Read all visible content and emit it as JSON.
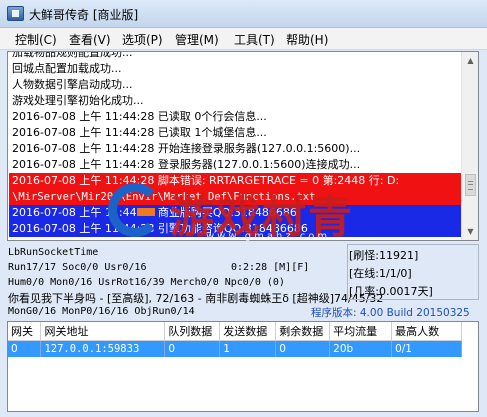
{
  "window": {
    "title": "大鲜哥传奇 [商业版]"
  },
  "menu": [
    {
      "label": "控制(C)"
    },
    {
      "label": "查看(V)"
    },
    {
      "label": "选项(P)"
    },
    {
      "label": "管理(M)"
    },
    {
      "label": "工具(T)"
    },
    {
      "label": "帮助(H)"
    }
  ],
  "log": [
    {
      "text": "加载物品规则配置成功...",
      "style": "normal"
    },
    {
      "text": "回城点配置加载成功...",
      "style": "normal"
    },
    {
      "text": "人物数据引擎启动成功...",
      "style": "normal"
    },
    {
      "text": "游戏处理引擎初始化成功...",
      "style": "normal"
    },
    {
      "text": "2016-07-08 上午 11:44:28 已读取 0个行会信息...",
      "style": "normal"
    },
    {
      "text": "2016-07-08 上午 11:44:28 已读取 1个城堡信息...",
      "style": "normal"
    },
    {
      "text": "2016-07-08 上午 11:44:28 开始连接登录服务器(127.0.0.1:5600)...",
      "style": "normal"
    },
    {
      "text": "2016-07-08 上午 11:44:28 登录服务器(127.0.0.1:5600)连接成功...",
      "style": "normal"
    },
    {
      "text": "2016-07-08 上午 11:44:28 脚本错误: RRTARGETRACE = 0 第:2448 行: D:",
      "style": "red"
    },
    {
      "text": "\\MirServer\\Mir200\\Envir\\Market_Def\\Functions.txt",
      "style": "red mono"
    },
    {
      "text": "2016-07-08 上午 11:44:28 商业版购买QQ:318486686",
      "style": "blue"
    },
    {
      "text": "2016-07-08 上午 11:44:28 引擎功能咨询QQ:318486686",
      "style": "blue"
    }
  ],
  "watermark": {
    "brand": "G",
    "word": "游戏村青",
    "url": "www.gmahz.com"
  },
  "status": {
    "socket": "LbRunSocketTime",
    "run": "Run17/17 Soc0/0 Usr0/16",
    "time": "0:2:28 [M][F]",
    "hum": "Hum0/0 Mon0/16 UsrRot16/39 Merch0/0 Npc0/0 (0)",
    "notice": "你看见我下半身吗 - [至高级], 72/163 - 南非剧毒蜘蛛王δ [超神级]74/45/32",
    "mon": "MonG0/16 MonP0/16/16 ObjRun0/14",
    "refresh": "[刷怪:11921]",
    "online": "[在线:1/1/0]",
    "rate": "[几率:0.0017天]",
    "version": "程序版本: 4.00 Build 20150325"
  },
  "table": {
    "headers": [
      "网关",
      "网关地址",
      "队列数据",
      "发送数据",
      "剩余数据",
      "平均流量",
      "最高人数"
    ],
    "rows": [
      [
        "0",
        "127.0.0.1:59833",
        "0",
        "1",
        "0",
        "20b",
        "0/1"
      ]
    ]
  }
}
